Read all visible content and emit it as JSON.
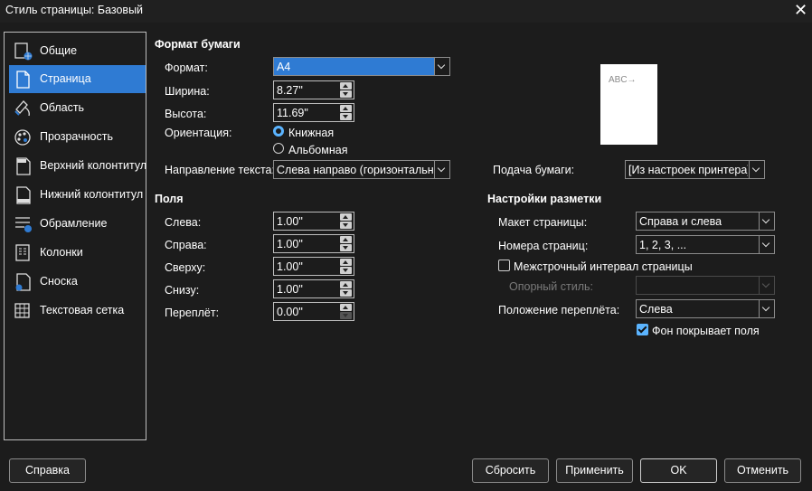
{
  "window": {
    "title": "Стиль страницы: Базовый"
  },
  "sidebar": {
    "items": [
      {
        "label": "Общие",
        "icon": "organizer-icon"
      },
      {
        "label": "Страница",
        "icon": "page-icon"
      },
      {
        "label": "Область",
        "icon": "area-icon"
      },
      {
        "label": "Прозрачность",
        "icon": "transparency-icon"
      },
      {
        "label": "Верхний колонтитул",
        "icon": "header-icon"
      },
      {
        "label": "Нижний колонтитул",
        "icon": "footer-icon"
      },
      {
        "label": "Обрамление",
        "icon": "borders-icon"
      },
      {
        "label": "Колонки",
        "icon": "columns-icon"
      },
      {
        "label": "Сноска",
        "icon": "footnote-icon"
      },
      {
        "label": "Текстовая сетка",
        "icon": "text-grid-icon"
      }
    ],
    "selected": "Страница"
  },
  "paper_format": {
    "section_title": "Формат бумаги",
    "format_label": "Формат:",
    "format_value": "A4",
    "width_label": "Ширина:",
    "width_value": "8.27\"",
    "height_label": "Высота:",
    "height_value": "11.69\"",
    "orientation_label": "Ориентация:",
    "portrait_label": "Книжная",
    "landscape_label": "Альбомная",
    "orientation_selected": "portrait",
    "text_direction_label": "Направление текста:",
    "text_direction_value": "Слева направо (горизонтально)",
    "paper_tray_label": "Подача бумаги:",
    "paper_tray_value": "[Из настроек принтера]",
    "preview_text": "ABC→"
  },
  "margins": {
    "section_title": "Поля",
    "left_label": "Слева:",
    "left_value": "1.00\"",
    "right_label": "Справа:",
    "right_value": "1.00\"",
    "top_label": "Сверху:",
    "top_value": "1.00\"",
    "bottom_label": "Снизу:",
    "bottom_value": "1.00\"",
    "gutter_label": "Переплёт:",
    "gutter_value": "0.00\""
  },
  "layout": {
    "section_title": "Настройки разметки",
    "page_layout_label": "Макет страницы:",
    "page_layout_value": "Справа и слева",
    "page_numbers_label": "Номера страниц:",
    "page_numbers_value": "1, 2, 3, ...",
    "register_true_label": "Межстрочный интервал страницы",
    "register_true_checked": false,
    "reference_style_label": "Опорный стиль:",
    "reference_style_value": "",
    "gutter_position_label": "Положение переплёта:",
    "gutter_position_value": "Слева",
    "background_covers_label": "Фон покрывает поля",
    "background_covers_checked": true
  },
  "buttons": {
    "help": "Справка",
    "reset": "Сбросить",
    "apply": "Применить",
    "ok": "OK",
    "cancel": "Отменить"
  },
  "colors": {
    "accent": "#2f7bd3",
    "radio_check": "#5bb4ff",
    "background": "#1c1c1c"
  }
}
